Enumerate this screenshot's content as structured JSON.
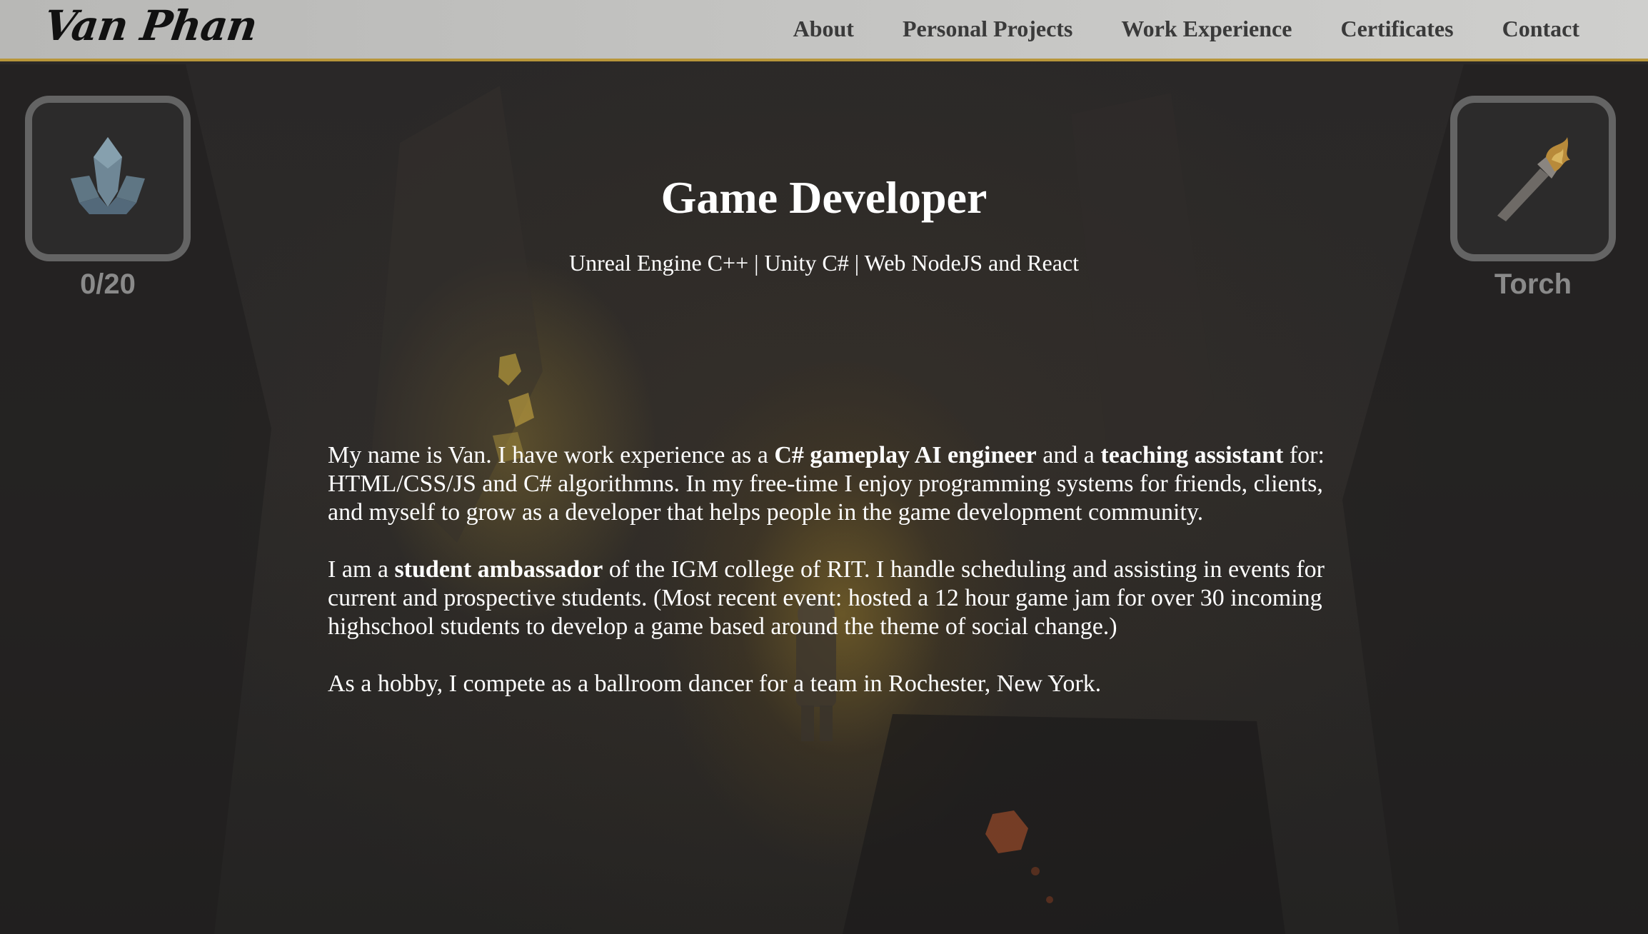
{
  "header": {
    "logo": "Van Phan",
    "nav": [
      "About",
      "Personal Projects",
      "Work Experience",
      "Certificates",
      "Contact"
    ]
  },
  "hud": {
    "left": {
      "icon": "crystal-icon",
      "label": "0/20"
    },
    "right": {
      "icon": "torch-icon",
      "label": "Torch"
    }
  },
  "hero": {
    "title": "Game Developer",
    "subtitle": "Unreal Engine C++ | Unity C# | Web NodeJS and React"
  },
  "bio": {
    "p1": {
      "a": "My name is Van. I have work experience as a ",
      "b": "C# gameplay AI engineer",
      "c": " and a ",
      "d": "teaching assistant",
      "e": " for: HTML/CSS/JS and C# algorithmns. In my free-time I enjoy programming systems for friends, clients, and myself to grow as a developer that helps people in the game development community."
    },
    "p2": {
      "a": "I am a ",
      "b": "student ambassador",
      "c": " of the IGM college of RIT. I handle scheduling and assisting in events for current and prospective students. (Most recent event: hosted a 12 hour game jam for over 30 incoming highschool students to develop a game based around the theme of social change.)"
    },
    "p3": "As a hobby, I compete as a ballroom dancer for a team in Rochester, New York."
  },
  "colors": {
    "nav_border": "#b8963a",
    "hud_outline": "#6e6e6e",
    "crystal": "#6f8796",
    "torch_flame": "#b88a3a"
  }
}
